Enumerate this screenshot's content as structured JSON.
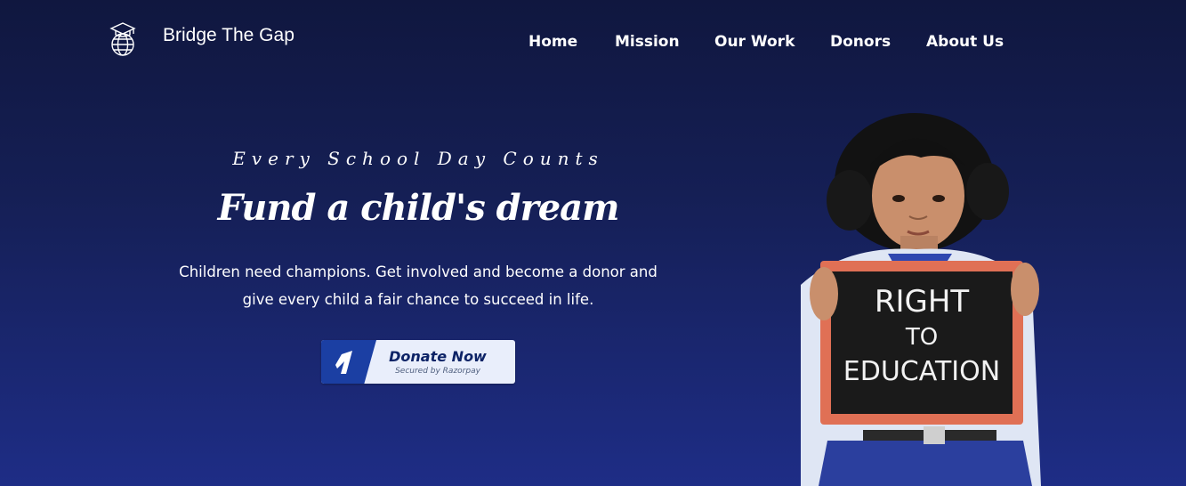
{
  "header": {
    "brand": "Bridge The Gap",
    "logo_icon": "globe-graduation-cap-icon",
    "nav": [
      {
        "label": "Home"
      },
      {
        "label": "Mission"
      },
      {
        "label": "Our Work"
      },
      {
        "label": "Donors"
      },
      {
        "label": "About Us"
      }
    ]
  },
  "hero": {
    "tagline": "Every School Day Counts",
    "headline": "Fund a child's dream",
    "description": "Children need champions. Get involved and become a donor and give every child a fair chance to succeed in life.",
    "donate_button": {
      "label": "Donate Now",
      "sublabel": "Secured by Razorpay",
      "icon": "razorpay-icon"
    },
    "photo": {
      "subject": "child-holding-chalkboard",
      "chalkboard_text": [
        "RIGHT",
        "TO",
        "EDUCATION"
      ]
    }
  },
  "colors": {
    "background_top": "#10173f",
    "background_bottom": "#1e2d86",
    "text": "#ffffff",
    "button_bg": "#e9eefb",
    "button_accent": "#1b3fa3",
    "button_text": "#0d2366"
  }
}
